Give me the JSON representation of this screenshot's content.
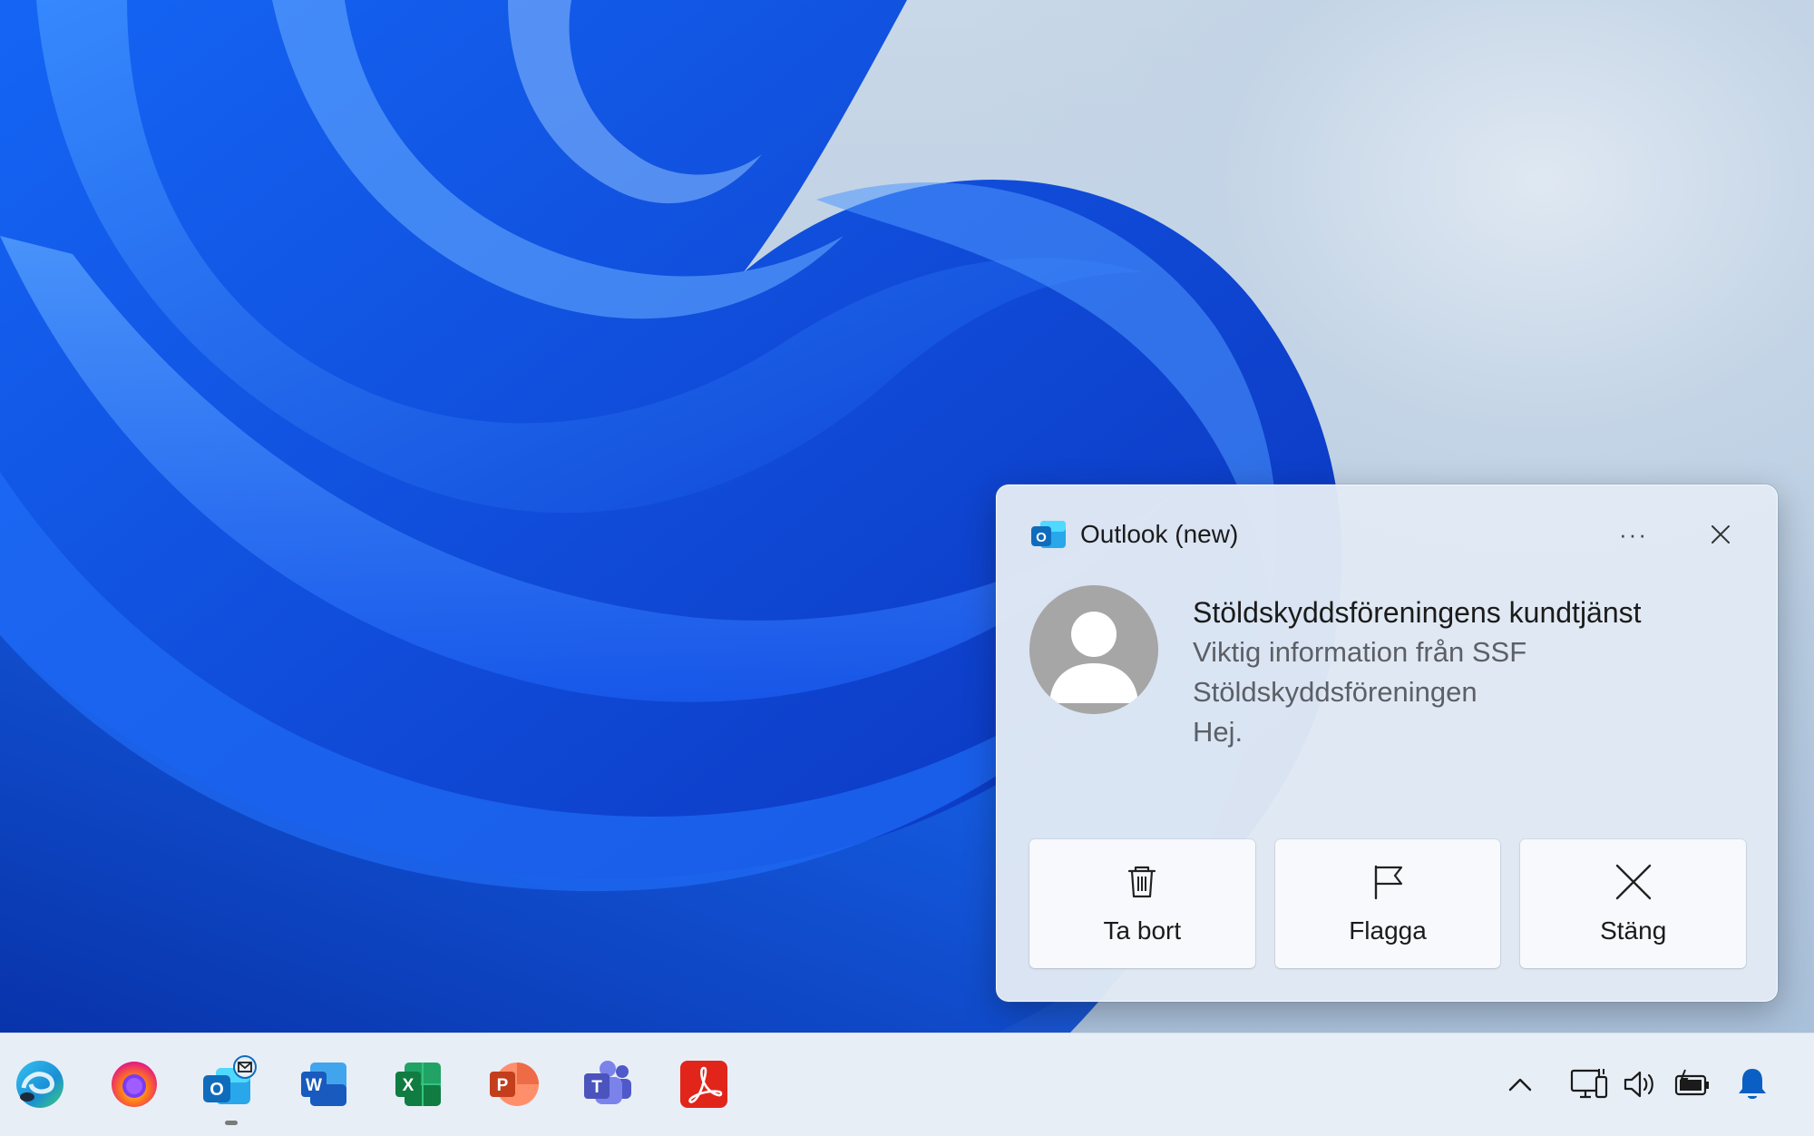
{
  "toast": {
    "app_name": "Outlook (new)",
    "more_label": "···",
    "sender": "Stöldskyddsföreningens kundtjänst",
    "subject": "Viktig information från SSF",
    "subject_cont": "Stöldskyddsföreningen",
    "preview": "Hej.",
    "actions": [
      {
        "label": "Ta bort",
        "icon": "trash-icon"
      },
      {
        "label": "Flagga",
        "icon": "flag-icon"
      },
      {
        "label": "Stäng",
        "icon": "close-x-icon"
      }
    ]
  },
  "taskbar": {
    "apps": [
      {
        "name": "edge",
        "icon": "edge-icon"
      },
      {
        "name": "firefox",
        "icon": "firefox-icon"
      },
      {
        "name": "outlook",
        "icon": "outlook-icon",
        "running": true
      },
      {
        "name": "word",
        "icon": "word-icon",
        "letter": "W"
      },
      {
        "name": "excel",
        "icon": "excel-icon",
        "letter": "X"
      },
      {
        "name": "powerpoint",
        "icon": "powerpoint-icon",
        "letter": "P"
      },
      {
        "name": "teams",
        "icon": "teams-icon",
        "letter": "T"
      },
      {
        "name": "acrobat",
        "icon": "acrobat-icon"
      }
    ],
    "tray": [
      "chevron-up-icon",
      "network-icon",
      "volume-icon",
      "battery-icon",
      "notification-bell-icon"
    ]
  },
  "colors": {
    "outlook_blue": "#0f6cbd",
    "word_blue": "#185abd",
    "excel_green": "#107c41",
    "ppt_orange": "#c43e1c",
    "teams_purple": "#5b5fc7",
    "acrobat_red": "#e1251b",
    "bell_blue": "#0a5fc4"
  }
}
